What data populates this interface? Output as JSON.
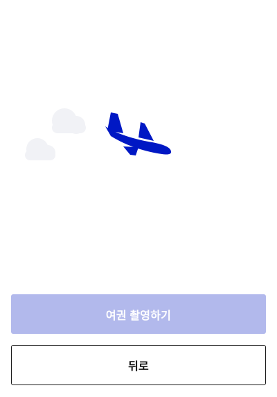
{
  "illustration": {
    "icons": [
      "cloud-icon",
      "cloud-icon",
      "airplane-icon"
    ],
    "colors": {
      "cloud": "#f1f2f6",
      "airplane": "#0018c4"
    }
  },
  "actions": {
    "primary_label": "여권 촬영하기",
    "primary_color": "#b2b9ec",
    "primary_disabled": true,
    "secondary_label": "뒤로",
    "secondary_border_color": "#1a1a1a"
  }
}
